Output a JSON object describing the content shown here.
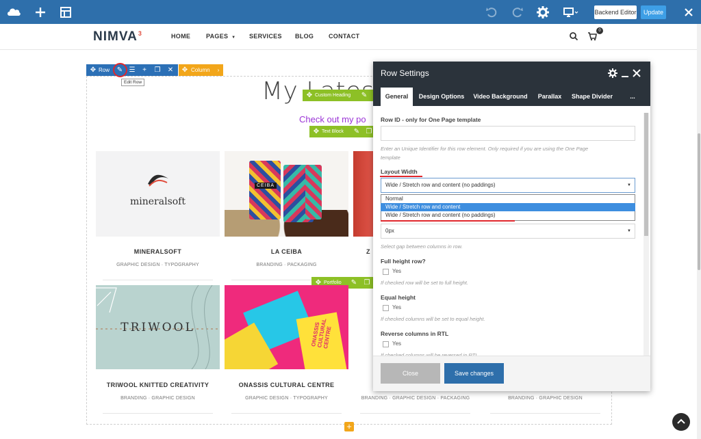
{
  "topbar": {
    "backend_editor": "Backend Editor",
    "update": "Update"
  },
  "site": {
    "logo_text": "NIMVA",
    "logo_sup": "3",
    "nav": [
      "HOME",
      "PAGES",
      "SERVICES",
      "BLOG",
      "CONTACT"
    ],
    "cart_count": "0"
  },
  "vc": {
    "row_label": "Row",
    "column_label": "Column",
    "tooltip": "Edit Row",
    "custom_heading_label": "Custom Heading",
    "text_block_label": "Text Block",
    "portfolio_label": "Portfolio"
  },
  "page": {
    "heading": "My Latest",
    "subheading": "Check out my po"
  },
  "cards": [
    {
      "title": "MINERALSOFT",
      "sub": "GRAPHIC DESIGN · TYPOGRAPHY",
      "logo": "mineralsoft"
    },
    {
      "title": "LA CEIBA",
      "sub": "BRANDING · PACKAGING",
      "logo": "CEIBA"
    },
    {
      "title": "Z",
      "sub": "",
      "logo": ""
    },
    {
      "title": "TRIWOOL KNITTED CREATIVITY",
      "sub": "BRANDING · GRAPHIC DESIGN",
      "logo": "TRIWOOL"
    },
    {
      "title": "ONASSIS CULTURAL CENTRE",
      "sub": "GRAPHIC DESIGN · TYPOGRAPHY",
      "logo": "ONASSIS CULTURAL CENTRE"
    },
    {
      "title": "",
      "sub": "BRANDING · GRAPHIC DESIGN · PACKAGING",
      "logo": ""
    },
    {
      "title": "",
      "sub": "BRANDING · GRAPHIC DESIGN",
      "logo": ""
    }
  ],
  "modal": {
    "title": "Row Settings",
    "tabs": [
      "General",
      "Design Options",
      "Video Background",
      "Parallax",
      "Shape Divider",
      "..."
    ],
    "row_id_label": "Row ID - only for One Page template",
    "row_id_help_1": "Enter an Unique Identifier for this row element. Only required if you are using the One Page",
    "row_id_help_2": "template",
    "layout_width_label": "Layout Width",
    "layout_width_value": "Wide / Stretch row and content (no paddings)",
    "layout_options": [
      "Normal",
      "Wide / Stretch row and content",
      "Wide / Stretch row and content (no paddings)"
    ],
    "gap_value": "0px",
    "gap_help": "Select gap between columns in row.",
    "full_height_label": "Full height row?",
    "full_height_help": "If checked row will be set to full height.",
    "equal_height_label": "Equal height",
    "equal_height_help": "If checked columns will be set to equal height.",
    "reverse_label": "Reverse columns in RTL",
    "reverse_help": "If checked columns will be reversed in RTL.",
    "yes": "Yes",
    "close": "Close",
    "save": "Save changes"
  },
  "colors": {
    "topbar": "#2e6fab",
    "vc_blue": "#2c70b6",
    "vc_orange": "#f2a61a",
    "vc_green": "#8dc026",
    "modal_head": "#2b333b",
    "highlight": "#3e8edf",
    "save_btn": "#2e6fab",
    "purple": "#9b34d6",
    "annotation_red": "#e0262b"
  }
}
